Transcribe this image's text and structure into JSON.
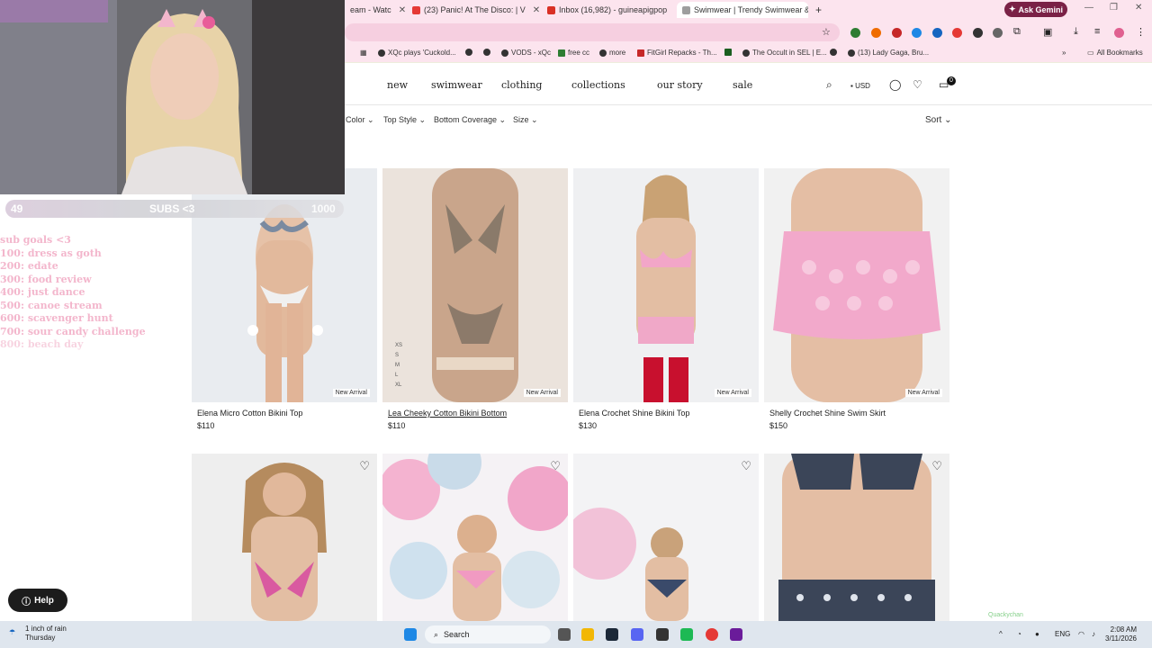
{
  "browser": {
    "tabs": [
      {
        "label": "eam - Watc",
        "favicon_color": "#e53935",
        "active": false
      },
      {
        "label": "(23) Panic! At The Disco: | V",
        "favicon_color": "#e53935",
        "active": false
      },
      {
        "label": "Inbox (16,982) - guineapigpop",
        "favicon_color": "#d93025",
        "active": false
      },
      {
        "label": "Swimwear | Trendy Swimwear &",
        "favicon_color": "#9e9e9e",
        "active": true
      }
    ],
    "new_tab_label": "+",
    "gemini_label": "Ask Gemini",
    "bookmarks": [
      "XQc plays 'Cuckold...",
      "VODS - xQc",
      "free cc",
      "more",
      "FitGirl Repacks - Th...",
      "The Occult in SEL | E...",
      "(13) Lady Gaga, Bru..."
    ],
    "all_bookmarks": "All Bookmarks"
  },
  "site": {
    "nav": [
      "new",
      "swimwear",
      "clothing",
      "collections",
      "our story",
      "sale"
    ],
    "currency": "USD",
    "cart_count": "0",
    "filters": [
      "Color",
      "Top Style",
      "Bottom Coverage",
      "Size"
    ],
    "sort_label": "Sort",
    "products_row1": [
      {
        "name": "Elena Micro Cotton Bikini Top",
        "price": "$110",
        "badge": "New Arrival"
      },
      {
        "name": "Lea Cheeky Cotton Bikini Bottom",
        "price": "$110",
        "badge": "New Arrival"
      },
      {
        "name": "Elena Crochet Shine Bikini Top",
        "price": "$130",
        "badge": "New Arrival"
      },
      {
        "name": "Shelly Crochet Shine Swim Skirt",
        "price": "$150",
        "badge": "New Arrival"
      }
    ],
    "sizes": [
      "XS",
      "S",
      "M",
      "L",
      "XL"
    ],
    "help_label": "Help"
  },
  "overlay": {
    "subs_current": "49",
    "subs_label": "SUBS <3",
    "subs_target": "1000",
    "subs_progress": 0.049,
    "goals_title": "sub goals <3",
    "goals": [
      "100: dress as goth",
      "200: edate",
      "300: food review",
      "400: just dance",
      "500: canoe stream",
      "600: scavenger hunt",
      "700: sour candy challenge",
      "800: beach day"
    ],
    "chat_user": "Quackychan"
  },
  "taskbar": {
    "weather_title": "1 inch of rain",
    "weather_sub": "Thursday",
    "search_label": "Search",
    "lang": "ENG",
    "time": "2:08 AM",
    "date": "3/11/2026"
  }
}
